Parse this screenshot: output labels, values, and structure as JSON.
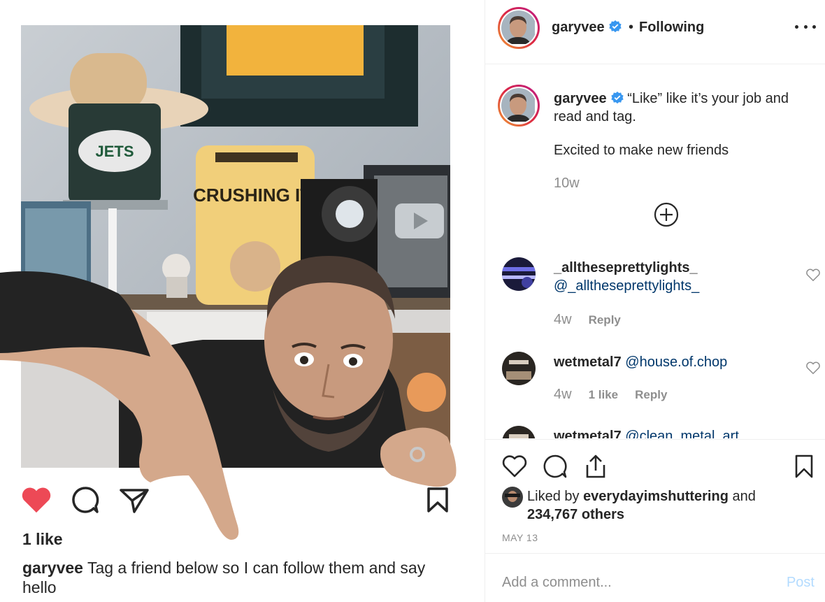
{
  "left_post": {
    "likes": "1 like",
    "caption_user": "garyvee",
    "caption_text": "Tag a friend below so I can follow them and say hello",
    "photo_pillow_text": "CRUSHING IT!",
    "photo_can_text": "JETS",
    "like_color": "#ed4956"
  },
  "header": {
    "username": "garyvee",
    "separator": "•",
    "follow_label": "Following",
    "verified_color": "#3897f0"
  },
  "caption": {
    "username": "garyvee",
    "text_line1": "“Like” like it’s your job and read and tag.",
    "text_line2": "Excited to make new friends",
    "time": "10w"
  },
  "comments": [
    {
      "username": "_alltheseprettylights_",
      "mention": "@_alltheseprettylights_",
      "time": "4w",
      "reply_label": "Reply"
    },
    {
      "username": "wetmetal7",
      "mention": "@house.of.chop",
      "time": "4w",
      "likes_label": "1 like",
      "reply_label": "Reply"
    },
    {
      "username": "wetmetal7",
      "mention": "@clean_metal_art"
    }
  ],
  "actions": {
    "liked_by_prefix": "Liked by",
    "liked_by_user": "everydayimshuttering",
    "liked_by_suffix": "and",
    "others": "234,767 others",
    "date": "MAY 13"
  },
  "add_comment": {
    "placeholder": "Add a comment...",
    "post_label": "Post"
  }
}
